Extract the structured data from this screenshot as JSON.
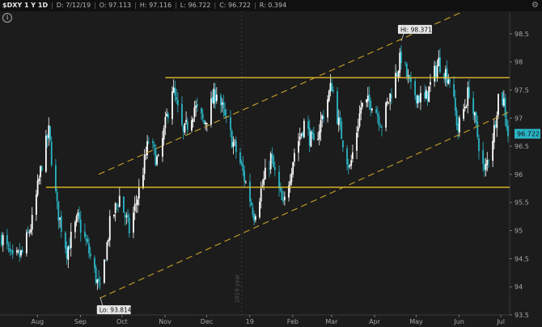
{
  "header": {
    "symbol": "$DXY 1 Y 1D",
    "date": "D: 7/12/19",
    "open": "O: 97.113",
    "high": "H: 97.116",
    "low": "L: 96.722",
    "close": "C: 96.722",
    "range": "R: 0.394",
    "settings_icon": "gear-icon",
    "info_icon": "info-icon",
    "info_glyph": "i"
  },
  "colors": {
    "background": "#1c1c1c",
    "up_candle": "#ffffff",
    "down_candle": "#2ab5c5",
    "channel_line": "#c9a227",
    "level_line": "#e6be2a",
    "price_badge": "#2ab5c5"
  },
  "chart_data": {
    "type": "candlestick",
    "title": "",
    "xlabel": "",
    "ylabel": "",
    "ylim": [
      93.5,
      98.9
    ],
    "grid": false,
    "x_tick_labels": [
      "Aug",
      "Sep",
      "Oct",
      "Nov",
      "Dec",
      "19",
      "Feb",
      "Mar",
      "Apr",
      "May",
      "Jun",
      "Jul"
    ],
    "x_tick_dates": [
      "2018-08-01",
      "2018-09-01",
      "2018-10-01",
      "2018-11-01",
      "2018-12-01",
      "2019-01-01",
      "2019-02-01",
      "2019-03-01",
      "2019-04-01",
      "2019-05-01",
      "2019-06-01",
      "2019-07-01"
    ],
    "y_ticks": [
      93.5,
      94,
      94.5,
      95,
      95.5,
      96,
      96.5,
      97,
      97.5,
      98,
      98.5
    ],
    "year_marker": "2019 year",
    "date_range": [
      "2018-07-12",
      "2019-07-12"
    ],
    "high_annotation": {
      "label": "Hi: 98.371",
      "date": "2019-04-26",
      "value": 98.371
    },
    "low_annotation": {
      "label": "Lo: 93.814",
      "date": "2018-09-21",
      "value": 93.814
    },
    "last_price": {
      "label": "96.722",
      "value": 96.722
    },
    "horizontal_levels": [
      97.72,
      95.77
    ],
    "channel_lines": [
      {
        "start": {
          "date": "2018-09-20",
          "value": 96.0
        },
        "end": {
          "date": "2019-06-10",
          "value": 98.9
        }
      },
      {
        "start": {
          "date": "2018-09-21",
          "value": 93.8
        },
        "end": {
          "date": "2019-07-12",
          "value": 97.1
        }
      }
    ],
    "anchor_points": [
      [
        "2018-07-12",
        94.9
      ],
      [
        "2018-07-20",
        94.45
      ],
      [
        "2018-07-27",
        94.6
      ],
      [
        "2018-08-03",
        95.15
      ],
      [
        "2018-08-10",
        96.2
      ],
      [
        "2018-08-15",
        96.75
      ],
      [
        "2018-08-21",
        95.4
      ],
      [
        "2018-08-28",
        94.65
      ],
      [
        "2018-09-05",
        95.2
      ],
      [
        "2018-09-12",
        94.7
      ],
      [
        "2018-09-21",
        93.9
      ],
      [
        "2018-09-28",
        95.1
      ],
      [
        "2018-10-05",
        95.6
      ],
      [
        "2018-10-12",
        95.0
      ],
      [
        "2018-10-19",
        95.7
      ],
      [
        "2018-10-26",
        96.6
      ],
      [
        "2018-11-02",
        96.2
      ],
      [
        "2018-11-12",
        97.55
      ],
      [
        "2018-11-20",
        96.7
      ],
      [
        "2018-11-28",
        97.2
      ],
      [
        "2018-12-05",
        96.9
      ],
      [
        "2018-12-14",
        97.5
      ],
      [
        "2018-12-21",
        96.9
      ],
      [
        "2018-12-31",
        96.2
      ],
      [
        "2019-01-10",
        95.3
      ],
      [
        "2019-01-22",
        96.3
      ],
      [
        "2019-01-31",
        95.4
      ],
      [
        "2019-02-08",
        96.4
      ],
      [
        "2019-02-15",
        96.9
      ],
      [
        "2019-02-22",
        96.5
      ],
      [
        "2019-03-07",
        97.6
      ],
      [
        "2019-03-12",
        96.9
      ],
      [
        "2019-03-20",
        96.1
      ],
      [
        "2019-03-28",
        97.2
      ],
      [
        "2019-04-05",
        97.3
      ],
      [
        "2019-04-12",
        96.9
      ],
      [
        "2019-04-18",
        97.4
      ],
      [
        "2019-04-26",
        98.1
      ],
      [
        "2019-05-03",
        97.5
      ],
      [
        "2019-05-13",
        97.3
      ],
      [
        "2019-05-23",
        98.0
      ],
      [
        "2019-05-31",
        97.7
      ],
      [
        "2019-06-06",
        96.8
      ],
      [
        "2019-06-14",
        97.5
      ],
      [
        "2019-06-25",
        96.0
      ],
      [
        "2019-07-02",
        96.8
      ],
      [
        "2019-07-05",
        97.4
      ],
      [
        "2019-07-09",
        97.3
      ],
      [
        "2019-07-12",
        96.72
      ]
    ]
  }
}
